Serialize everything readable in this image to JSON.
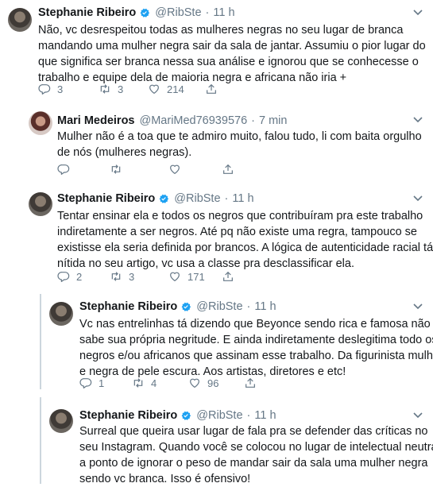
{
  "tweets": [
    {
      "name": "Stephanie Ribeiro",
      "handle": "@RibSte",
      "time": "11 h",
      "lines": [
        "Não, vc desrespeitou todas as mulheres negras no seu lugar de branca",
        "mandando uma mulher negra sair da sala de jantar. Assumiu o pior lugar do",
        "que significa ser branca nessa sua análise e ignorou que se conhecesse o",
        "trabalho e equipe dela de maioria negra e africana não iria +"
      ],
      "replies": "3",
      "retweets": "3",
      "likes": "214"
    },
    {
      "name": "Mari Medeiros",
      "handle": "@MariMed76939576",
      "time": "7 min",
      "lines": [
        "Mulher não é a toa que te admiro muito, falou tudo, li com baita orgulho",
        "de nós (mulheres negras)."
      ],
      "replies": "",
      "retweets": "",
      "likes": ""
    },
    {
      "name": "Stephanie Ribeiro",
      "handle": "@RibSte",
      "time": "11 h",
      "lines": [
        "Tentar ensinar ela e todos os negros que contribuíram pra este trabalho",
        "indiretamente a ser negros. Até pq não existe uma regra, tampouco se",
        "existisse ela seria definida por brancos. A lógica de autenticidade racial tá",
        "nítida no seu artigo, vc usa a classe pra desclassificar ela."
      ],
      "replies": "2",
      "retweets": "3",
      "likes": "171"
    },
    {
      "name": "Stephanie Ribeiro",
      "handle": "@RibSte",
      "time": "11 h",
      "lines": [
        "Vc nas entrelinhas tá dizendo que Beyonce sendo rica e famosa não",
        "sabe sua própria negritude. E ainda indiretamente deslegitima todo os",
        "negros e/ou africanos que assinam esse trabalho. Da figurinista mulher",
        "e negra de pele escura. Aos artistas, diretores e etc!"
      ],
      "replies": "1",
      "retweets": "4",
      "likes": "96"
    },
    {
      "name": "Stephanie Ribeiro",
      "handle": "@RibSte",
      "time": "11 h",
      "lines": [
        "Surreal que queira usar lugar de fala pra se defender das críticas no",
        "seu Instagram. Quando você se colocou no lugar de intelectual neutra",
        "a ponto de ignorar o peso de mandar sair da sala uma mulher negra",
        "sendo vc branca. Isso é ofensivo!"
      ],
      "replies": "",
      "retweets": "",
      "likes": ""
    }
  ],
  "colors": {
    "verified": "#1da1f2",
    "muted": "#657786",
    "text": "#14171a",
    "thread_line": "#ccd6dd"
  },
  "icons": [
    "reply-icon",
    "retweet-icon",
    "like-icon",
    "share-icon",
    "verified-badge-icon",
    "chevron-down-icon"
  ]
}
